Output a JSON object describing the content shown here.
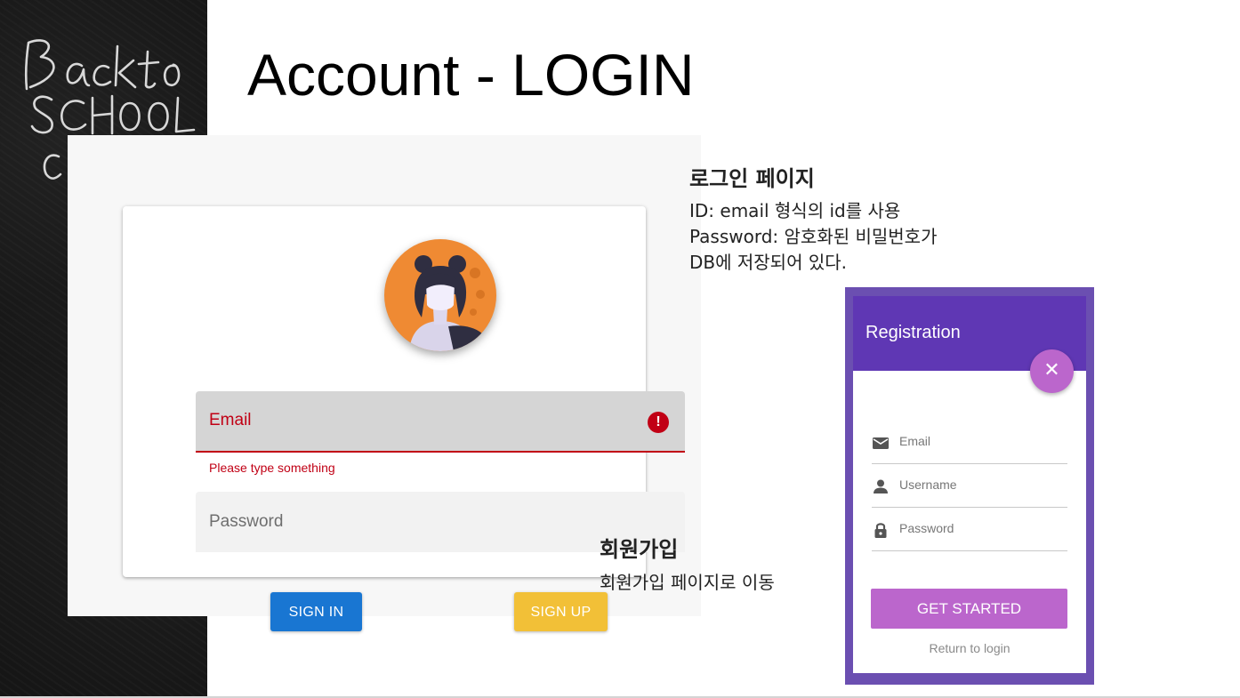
{
  "slide": {
    "title": "Account - LOGIN",
    "background_art": "Back to SCHOOL"
  },
  "login": {
    "avatar_icon": "avatar-icon",
    "email_label": "Email",
    "email_error_icon": "exclamation-icon",
    "email_error_text": "Please type something",
    "password_label": "Password",
    "signin_label": "SIGN IN",
    "signup_label": "SIGN UP",
    "colors": {
      "error": "#c10015",
      "signin": "#1976d2",
      "signup": "#f2c037"
    }
  },
  "notes": {
    "login": {
      "heading": "로그인 페이지",
      "lines": [
        "ID: email 형식의 id를 사용",
        "Password: 암호화된 비밀번호가",
        "DB에 저장되어 있다."
      ]
    },
    "signup": {
      "heading": "회원가입",
      "line": "회원가입 페이지로 이동"
    }
  },
  "registration": {
    "title": "Registration",
    "close_icon": "close-icon",
    "fields": [
      {
        "icon": "envelope-icon",
        "placeholder": "Email"
      },
      {
        "icon": "person-icon",
        "placeholder": "Username"
      },
      {
        "icon": "lock-icon",
        "placeholder": "Password"
      }
    ],
    "submit_label": "GET STARTED",
    "return_link": "Return to login",
    "colors": {
      "header": "#5f37b4",
      "accent": "#bb66cc"
    }
  }
}
